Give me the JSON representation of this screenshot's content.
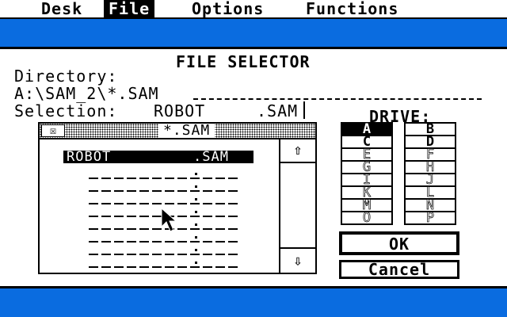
{
  "menu": {
    "items": [
      {
        "label": "Desk"
      },
      {
        "label": "File"
      },
      {
        "label": "Options"
      },
      {
        "label": "Functions"
      }
    ],
    "active_label": "File"
  },
  "dialog": {
    "title": "FILE SELECTOR",
    "directory_label": "Directory:",
    "directory_path": "A:\\SAM_2\\*.SAM",
    "selection_label": "Selection:",
    "selection_name": "ROBOT",
    "selection_ext": ".SAM",
    "file_list": {
      "close_glyph": "☒",
      "mask": "*.SAM",
      "files": [
        {
          "name": "ROBOT",
          "ext": ".SAM",
          "selected": true
        }
      ],
      "empty_row_count": 8
    },
    "scroll": {
      "up_icon": "up-arrow-icon",
      "down_icon": "down-arrow-icon",
      "up_glyph": "⇧",
      "down_glyph": "⇩"
    },
    "drive": {
      "label": "DRIVE:",
      "col1": [
        "A",
        "C",
        "E",
        "G",
        "I",
        "K",
        "M",
        "O"
      ],
      "col2": [
        "B",
        "D",
        "F",
        "H",
        "J",
        "L",
        "N",
        "P"
      ],
      "selected": "A",
      "available": [
        "A",
        "B",
        "C",
        "D"
      ]
    },
    "ok_label": "OK",
    "cancel_label": "Cancel"
  },
  "colors": {
    "desktop_blue": "#0a6ce0",
    "black": "#000000",
    "white": "#ffffff"
  }
}
